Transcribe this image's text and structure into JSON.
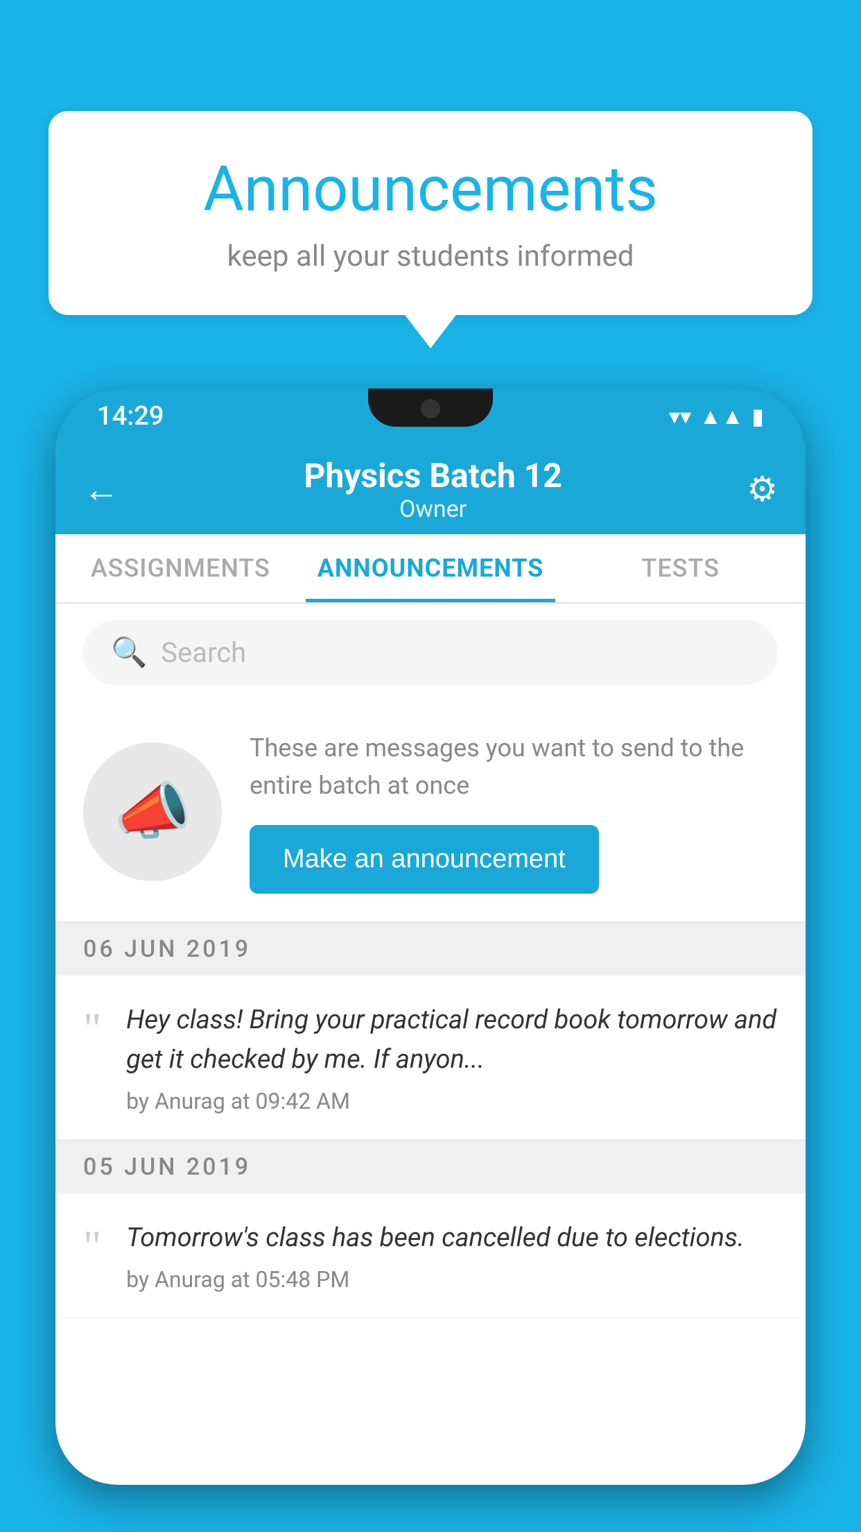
{
  "background_color": "#1ab3e8",
  "speech_bubble": {
    "title": "Announcements",
    "subtitle": "keep all your students informed"
  },
  "phone": {
    "status_bar": {
      "time": "14:29",
      "icons": [
        "wifi",
        "signal",
        "battery"
      ]
    },
    "header": {
      "title": "Physics Batch 12",
      "subtitle": "Owner",
      "back_label": "←",
      "gear_label": "⚙"
    },
    "tabs": [
      {
        "label": "ASSIGNMENTS",
        "active": false
      },
      {
        "label": "ANNOUNCEMENTS",
        "active": true
      },
      {
        "label": "TESTS",
        "active": false
      }
    ],
    "search": {
      "placeholder": "Search"
    },
    "announcement_banner": {
      "description": "These are messages you want to send to the entire batch at once",
      "button_label": "Make an announcement"
    },
    "messages": [
      {
        "date": "06  JUN  2019",
        "text": "Hey class! Bring your practical record book tomorrow and get it checked by me. If anyon...",
        "author": "by Anurag at 09:42 AM"
      },
      {
        "date": "05  JUN  2019",
        "text": "Tomorrow's class has been cancelled due to elections.",
        "author": "by Anurag at 05:48 PM"
      }
    ]
  }
}
